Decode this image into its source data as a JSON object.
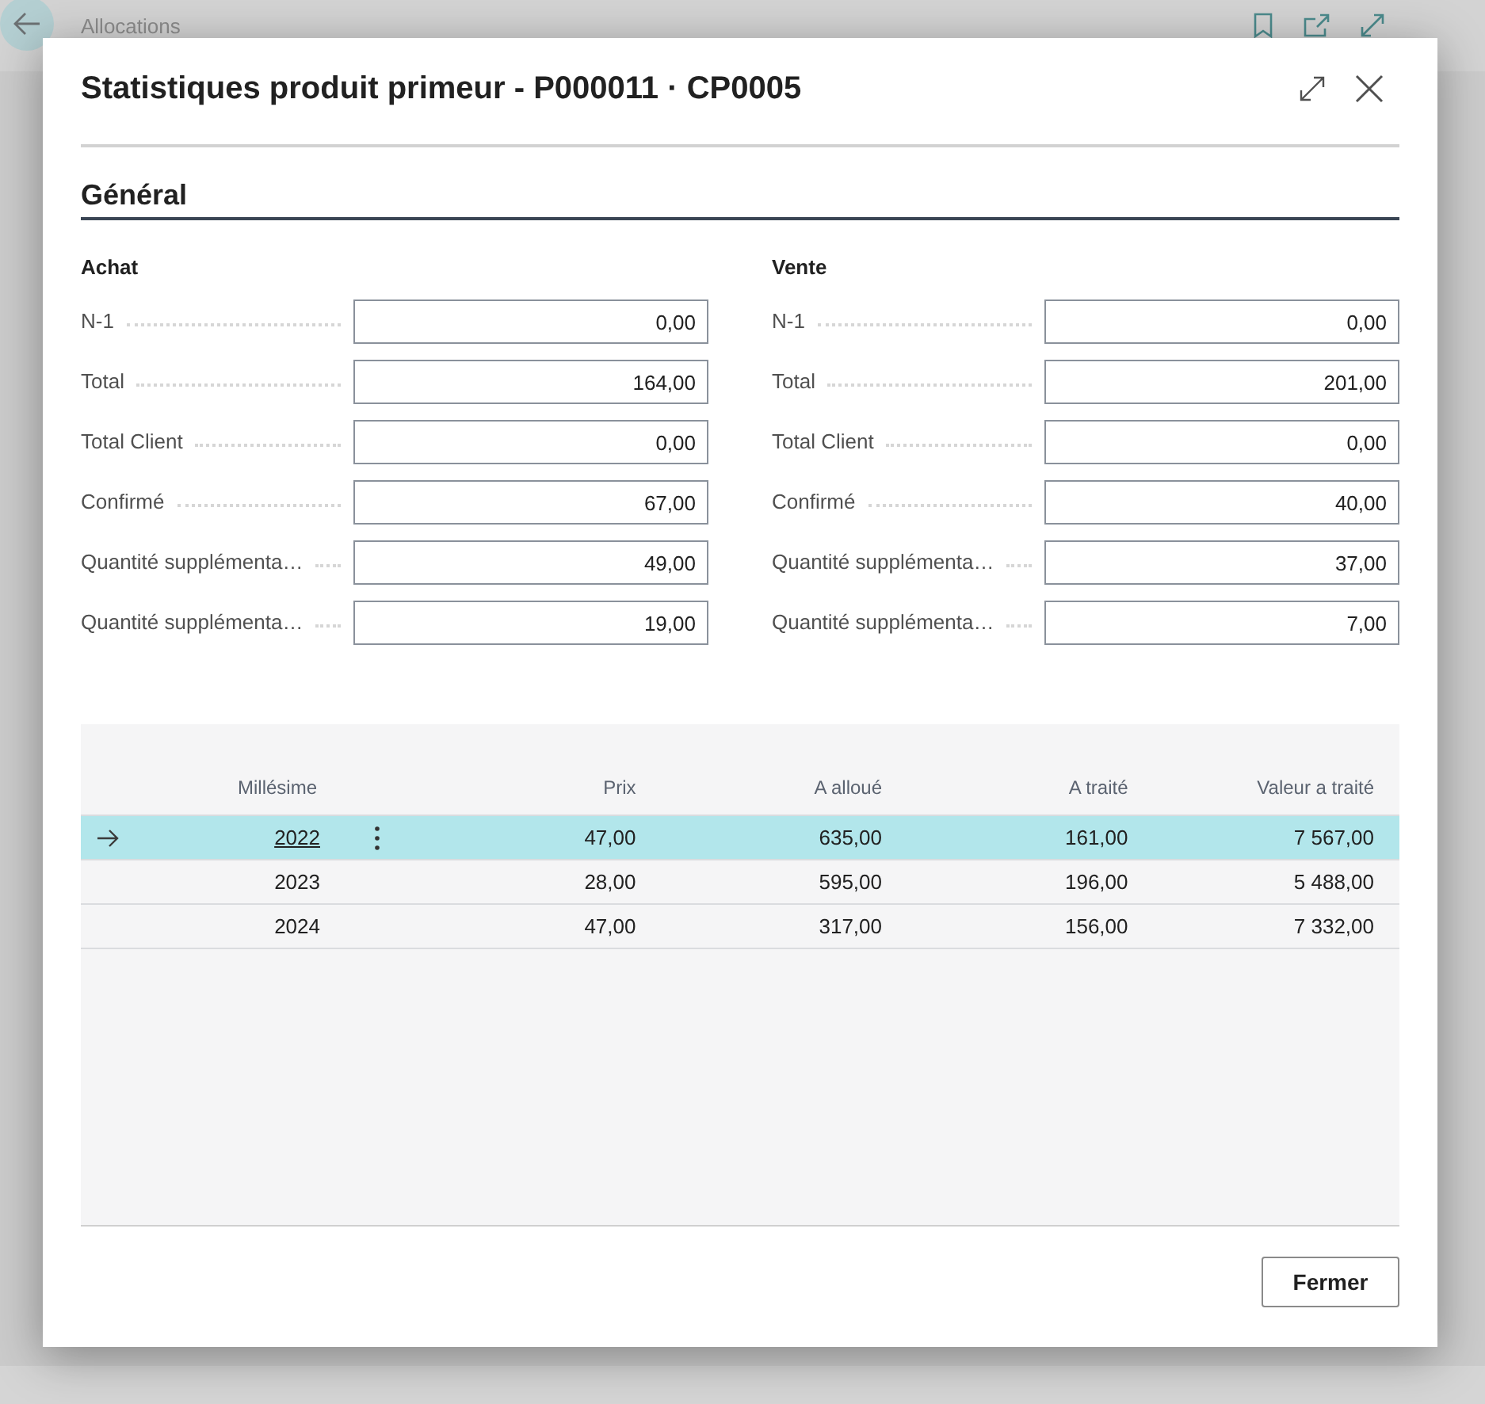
{
  "background_page": {
    "title": "Allocations"
  },
  "dialog": {
    "title": "Statistiques produit primeur - P000011 · CP0005",
    "section": "Général",
    "groups": [
      {
        "title": "Achat",
        "fields": [
          {
            "label": "N-1",
            "value": "0,00"
          },
          {
            "label": "Total",
            "value": "164,00"
          },
          {
            "label": "Total Client",
            "value": "0,00"
          },
          {
            "label": "Confirmé",
            "value": "67,00"
          },
          {
            "label": "Quantité supplémenta…",
            "value": "49,00"
          },
          {
            "label": "Quantité supplémenta…",
            "value": "19,00"
          }
        ]
      },
      {
        "title": "Vente",
        "fields": [
          {
            "label": "N-1",
            "value": "0,00"
          },
          {
            "label": "Total",
            "value": "201,00"
          },
          {
            "label": "Total Client",
            "value": "0,00"
          },
          {
            "label": "Confirmé",
            "value": "40,00"
          },
          {
            "label": "Quantité supplémenta…",
            "value": "37,00"
          },
          {
            "label": "Quantité supplémenta…",
            "value": "7,00"
          }
        ]
      }
    ],
    "table": {
      "columns": [
        "Millésime",
        "Prix",
        "A alloué",
        "A traité",
        "Valeur a traité"
      ],
      "rows": [
        {
          "selected": true,
          "cells": [
            "2022",
            "47,00",
            "635,00",
            "161,00",
            "7 567,00"
          ]
        },
        {
          "selected": false,
          "cells": [
            "2023",
            "28,00",
            "595,00",
            "196,00",
            "5 488,00"
          ]
        },
        {
          "selected": false,
          "cells": [
            "2024",
            "47,00",
            "317,00",
            "156,00",
            "7 332,00"
          ]
        }
      ]
    },
    "buttons": [
      "Fermer"
    ]
  }
}
